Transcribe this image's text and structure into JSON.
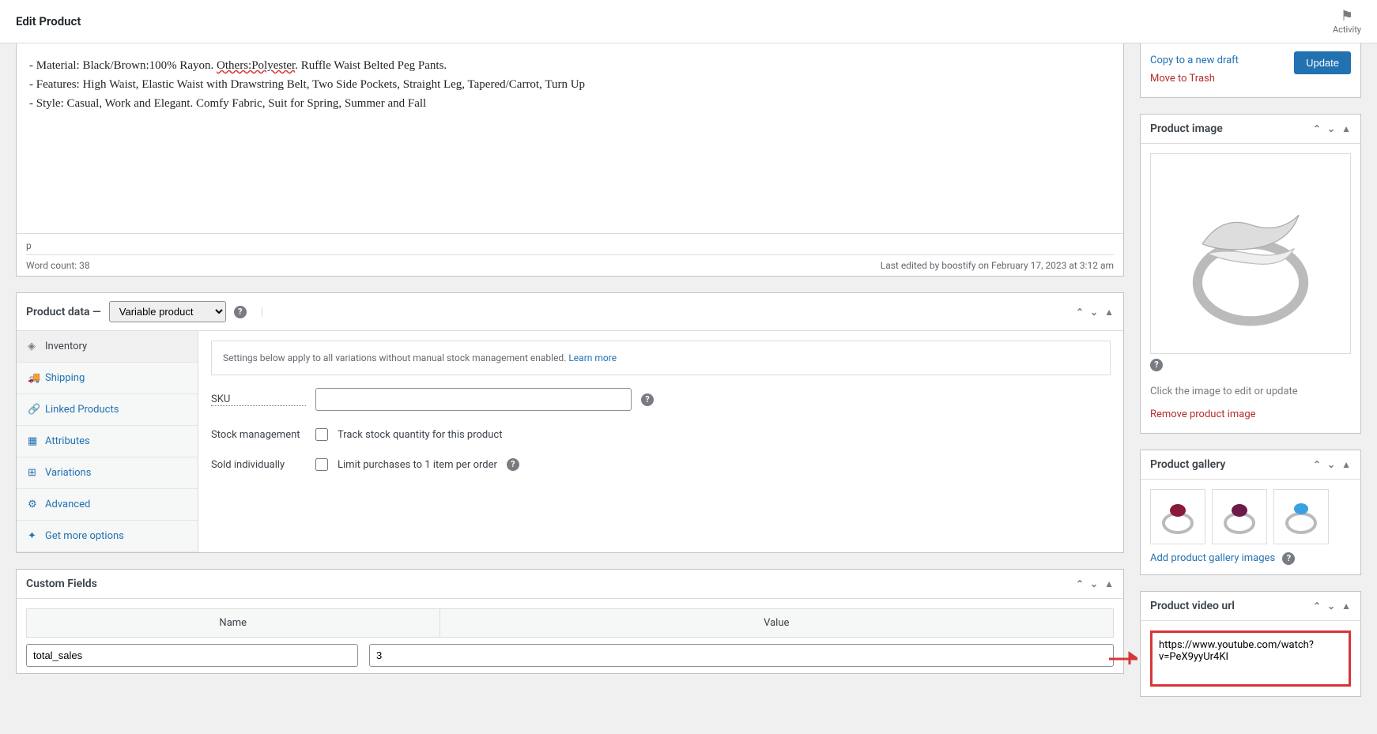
{
  "header": {
    "title": "Edit Product",
    "activity_label": "Activity"
  },
  "editor": {
    "lines": {
      "l1_prefix": "- Material: Black/Brown:100% Rayon. ",
      "l1_underlined": "Others:Polyester",
      "l1_suffix": ". Ruffle Waist Belted Peg Pants.",
      "l2": "- Features: High Waist, Elastic Waist with Drawstring Belt, Two Side Pockets, Straight Leg, Tapered/Carrot, Turn Up",
      "l3": "- Style: Casual, Work and Elegant. Comfy Fabric, Suit for Spring, Summer and Fall"
    },
    "path_indicator": "p",
    "word_count": "Word count: 38",
    "last_edited": "Last edited by boostify on February 17, 2023 at 3:12 am"
  },
  "product_data": {
    "title": "Product data —",
    "select_value": "Variable product",
    "tabs": [
      {
        "label": "Inventory",
        "active": true,
        "icon": "◈"
      },
      {
        "label": "Shipping",
        "active": false,
        "icon": "🚚"
      },
      {
        "label": "Linked Products",
        "active": false,
        "icon": "🔗"
      },
      {
        "label": "Attributes",
        "active": false,
        "icon": "▦"
      },
      {
        "label": "Variations",
        "active": false,
        "icon": "⊞"
      },
      {
        "label": "Advanced",
        "active": false,
        "icon": "⚙"
      },
      {
        "label": "Get more options",
        "active": false,
        "icon": "✦"
      }
    ],
    "notice_text": "Settings below apply to all variations without manual stock management enabled. ",
    "notice_link": "Learn more",
    "sku_label": "SKU",
    "sku_value": "",
    "stock_mgmt_label": "Stock management",
    "stock_mgmt_checkbox": "Track stock quantity for this product",
    "sold_individually_label": "Sold individually",
    "sold_individually_checkbox": "Limit purchases to 1 item per order"
  },
  "custom_fields": {
    "title": "Custom Fields",
    "col_name": "Name",
    "col_value": "Value",
    "row_name": "total_sales",
    "row_value": "3"
  },
  "publish": {
    "copy_link": "Copy to a new draft",
    "trash_link": "Move to Trash",
    "update_btn": "Update"
  },
  "product_image": {
    "title": "Product image",
    "edit_hint": "Click the image to edit or update",
    "remove_link": "Remove product image"
  },
  "gallery": {
    "title": "Product gallery",
    "add_link": "Add product gallery images"
  },
  "video": {
    "title": "Product video url",
    "value": "https://www.youtube.com/watch?v=PeX9yyUr4KI"
  }
}
